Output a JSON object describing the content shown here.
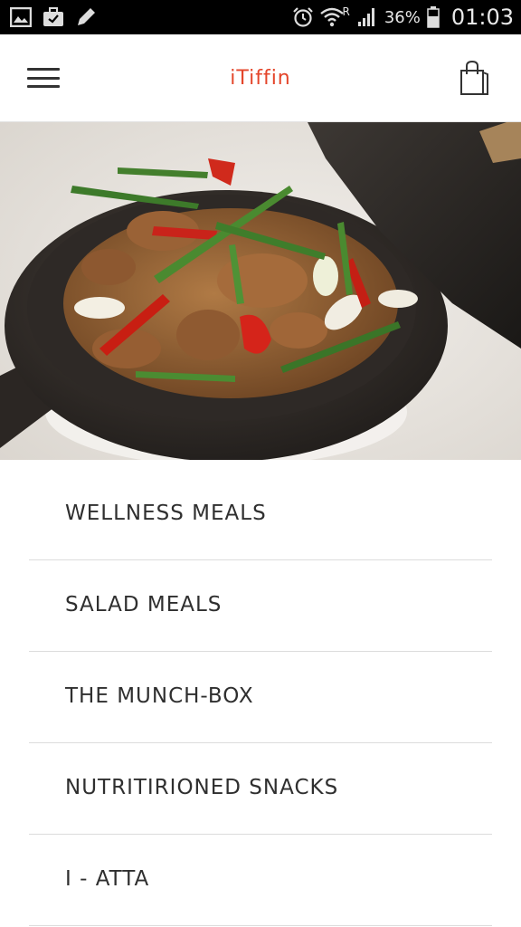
{
  "status_bar": {
    "battery_percent": "36%",
    "time": "01:03",
    "roaming_indicator": "R",
    "icons": [
      "gallery-icon",
      "briefcase-icon",
      "pencil-icon",
      "alarm-icon",
      "wifi-icon",
      "signal-icon",
      "battery-icon"
    ]
  },
  "header": {
    "title": "iTiffin",
    "menu_icon": "hamburger-menu-icon",
    "cart_icon": "shopping-bag-icon"
  },
  "colors": {
    "brand": "#e4452a",
    "text": "#2f2f2f",
    "divider": "#dcdcdc"
  },
  "categories": [
    {
      "label": "WELLNESS MEALS"
    },
    {
      "label": "SALAD MEALS"
    },
    {
      "label": "THE MUNCH-BOX"
    },
    {
      "label": "NUTRITIRIONED SNACKS"
    },
    {
      "label": "I - ATTA"
    }
  ]
}
